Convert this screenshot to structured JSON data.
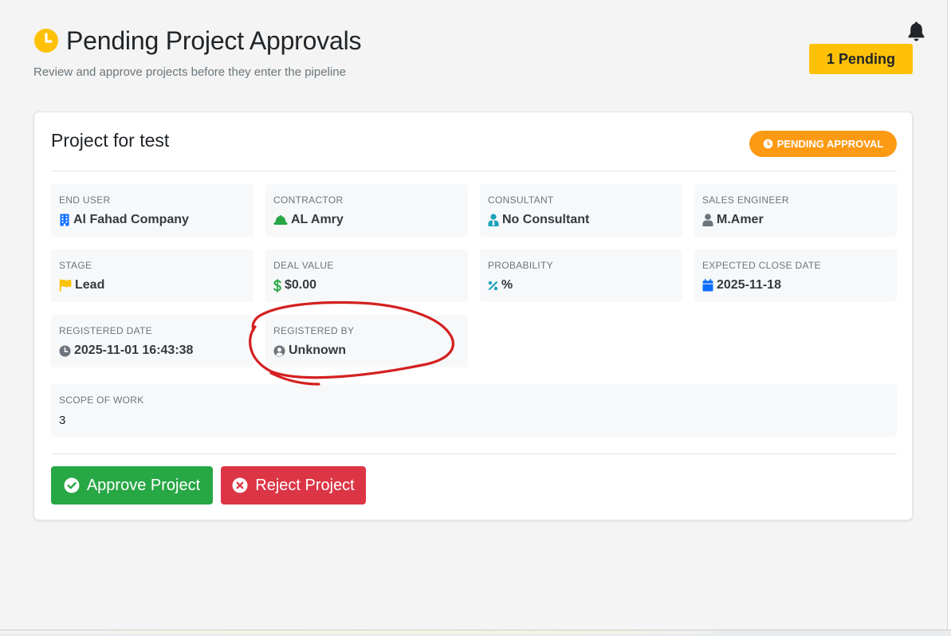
{
  "header": {
    "title": "Pending Project Approvals",
    "subtitle": "Review and approve projects before they enter the pipeline",
    "title_icon": "clock-icon",
    "notification_icon": "bell-icon",
    "pending_count_label": "1 Pending"
  },
  "project": {
    "name": "Project for test",
    "status_badge": "PENDING APPROVAL",
    "fields": {
      "end_user": {
        "label": "END USER",
        "value": "Al Fahad Company",
        "icon": "building-icon"
      },
      "contractor": {
        "label": "CONTRACTOR",
        "value": "AL Amry",
        "icon": "hard-hat-icon"
      },
      "consultant": {
        "label": "CONSULTANT",
        "value": "No Consultant",
        "icon": "user-tie-icon"
      },
      "sales_engineer": {
        "label": "SALES ENGINEER",
        "value": "M.Amer",
        "icon": "user-icon"
      },
      "stage": {
        "label": "STAGE",
        "value": "Lead",
        "icon": "flag-icon"
      },
      "deal_value": {
        "label": "DEAL VALUE",
        "value": "$0.00",
        "icon": "dollar-icon"
      },
      "probability": {
        "label": "PROBABILITY",
        "value": "%",
        "icon": "percent-icon"
      },
      "expected_close_date": {
        "label": "EXPECTED CLOSE DATE",
        "value": "2025-11-18",
        "icon": "calendar-icon"
      },
      "registered_date": {
        "label": "REGISTERED DATE",
        "value": "2025-11-01 16:43:38",
        "icon": "clock-icon"
      },
      "registered_by": {
        "label": "REGISTERED BY",
        "value": "Unknown",
        "icon": "user-circle-icon"
      }
    },
    "scope_of_work": {
      "label": "SCOPE OF WORK",
      "value": "3"
    }
  },
  "actions": {
    "approve_label": "Approve Project",
    "reject_label": "Reject Project"
  },
  "colors": {
    "warning": "#ffc107",
    "badge_orange": "#fd9a14",
    "approve_green": "#28a745",
    "reject_red": "#dc3545",
    "annotation_red": "#d42020"
  }
}
